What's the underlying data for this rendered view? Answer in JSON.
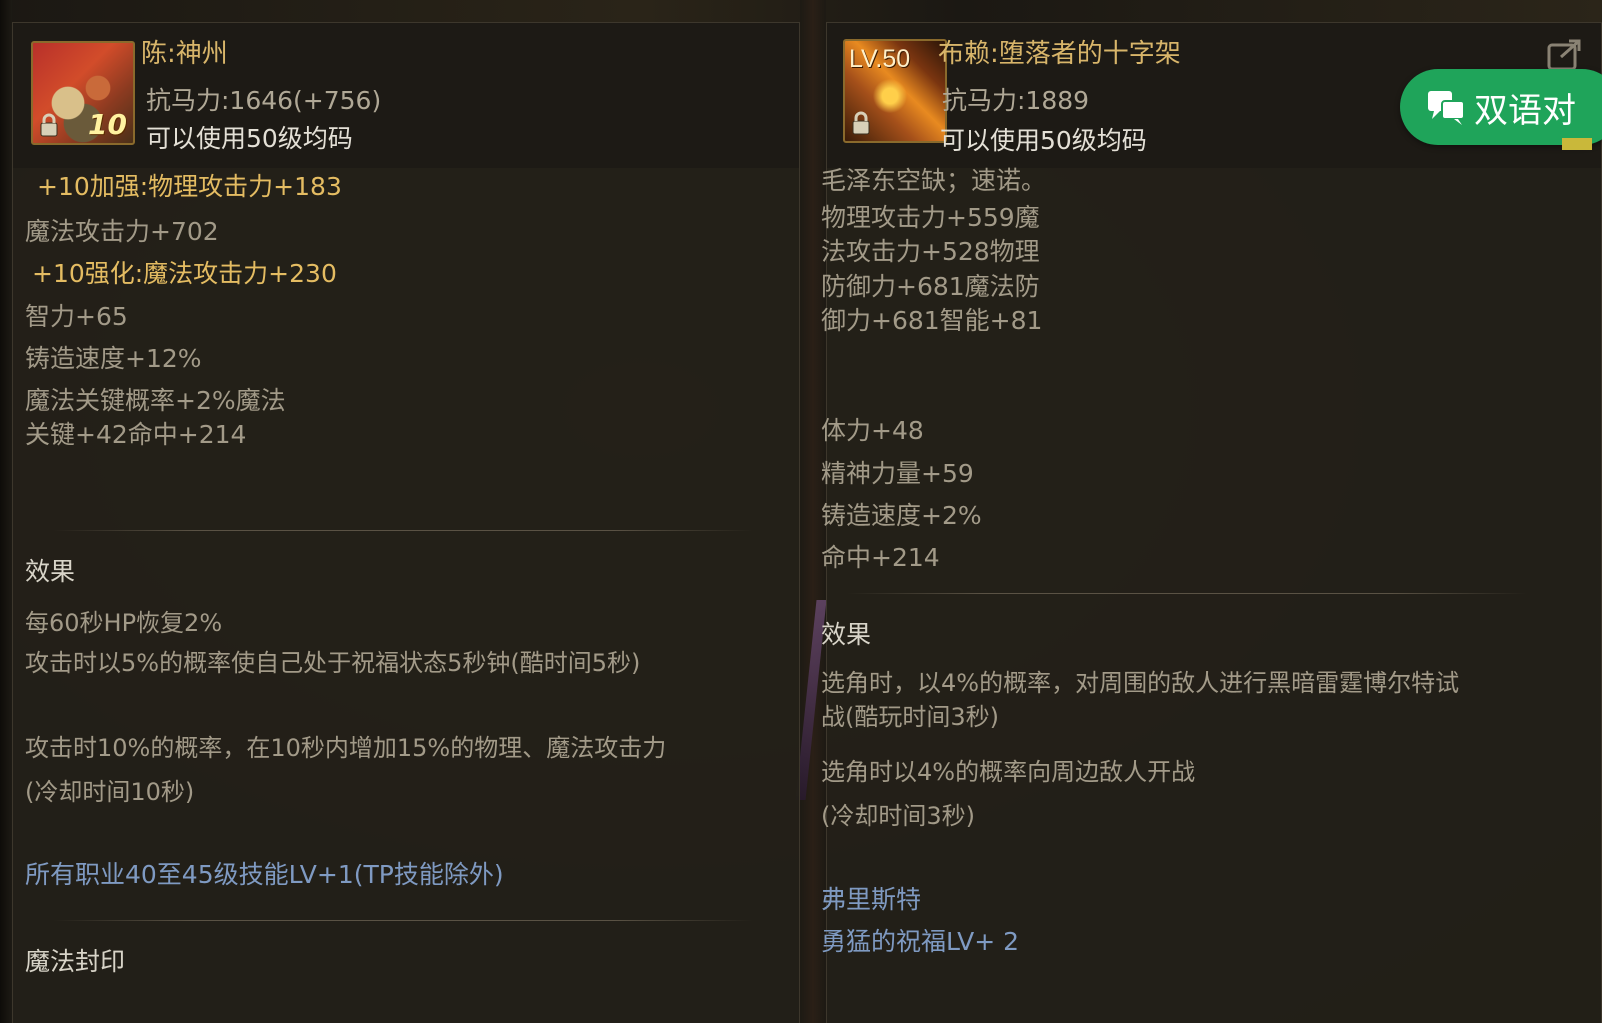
{
  "left_item": {
    "name": "陈:神州",
    "icon": "lollipop-box-icon",
    "icon_number": "10",
    "resistance": "抗马力:1646(+756)",
    "usable": "可以使用50级均码",
    "stats": [
      {
        "text": "+10加强:物理攻击力+183",
        "style": "gold"
      },
      {
        "text": "魔法攻击力+702",
        "style": "stat"
      },
      {
        "text": "+10强化:魔法攻击力+230",
        "style": "gold"
      },
      {
        "text": "智力+65",
        "style": "stat"
      },
      {
        "text": "铸造速度+12%",
        "style": "stat"
      },
      {
        "text": "魔法关键概率+2%魔法",
        "style": "stat"
      },
      {
        "text": "关键+42命中+214",
        "style": "stat"
      }
    ],
    "effect_title": "效果",
    "effects": [
      "每60秒HP恢复2%",
      "攻击时以5%的概率使自己处于祝福状态5秒钟(酷时间5秒)",
      "攻击时10%的概率，在10秒内增加15%的物理、魔法攻击力",
      "(冷却时间10秒)"
    ],
    "skill_bonus": "所有职业40至45级技能LV+1(TP技能除外)",
    "seal_title": "魔法封印"
  },
  "right_item": {
    "name": "布赖:堕落者的十字架",
    "icon": "golden-cross-icon",
    "icon_level": "LV.50",
    "resistance": "抗马力:1889",
    "usable": "可以使用50级均码",
    "stats_top": [
      "毛泽东空缺；速诺。",
      "物理攻击力+559魔",
      "法攻击力+528物理",
      "防御力+681魔法防",
      "御力+681智能+81"
    ],
    "stats_bottom": [
      "体力+48",
      "精神力量+59",
      "铸造速度+2%",
      "命中+214"
    ],
    "effect_title": "效果",
    "effects": [
      "选角时，以4%的概率，对周围的敌人进行黑暗雷霆博尔特试",
      "战(酷玩时间3秒)",
      "选角时以4%的概率向周边敌人开战",
      "(冷却时间3秒)"
    ],
    "set_name": "弗里斯特",
    "set_bonus": "勇猛的祝福LV+ 2"
  },
  "translate_button": {
    "label": "双语对",
    "color": "#1fa45a"
  },
  "colors": {
    "gold": "#e4bc62",
    "name": "#d8b56a",
    "skill": "#7f9ac2",
    "stat": "#a29a88"
  }
}
